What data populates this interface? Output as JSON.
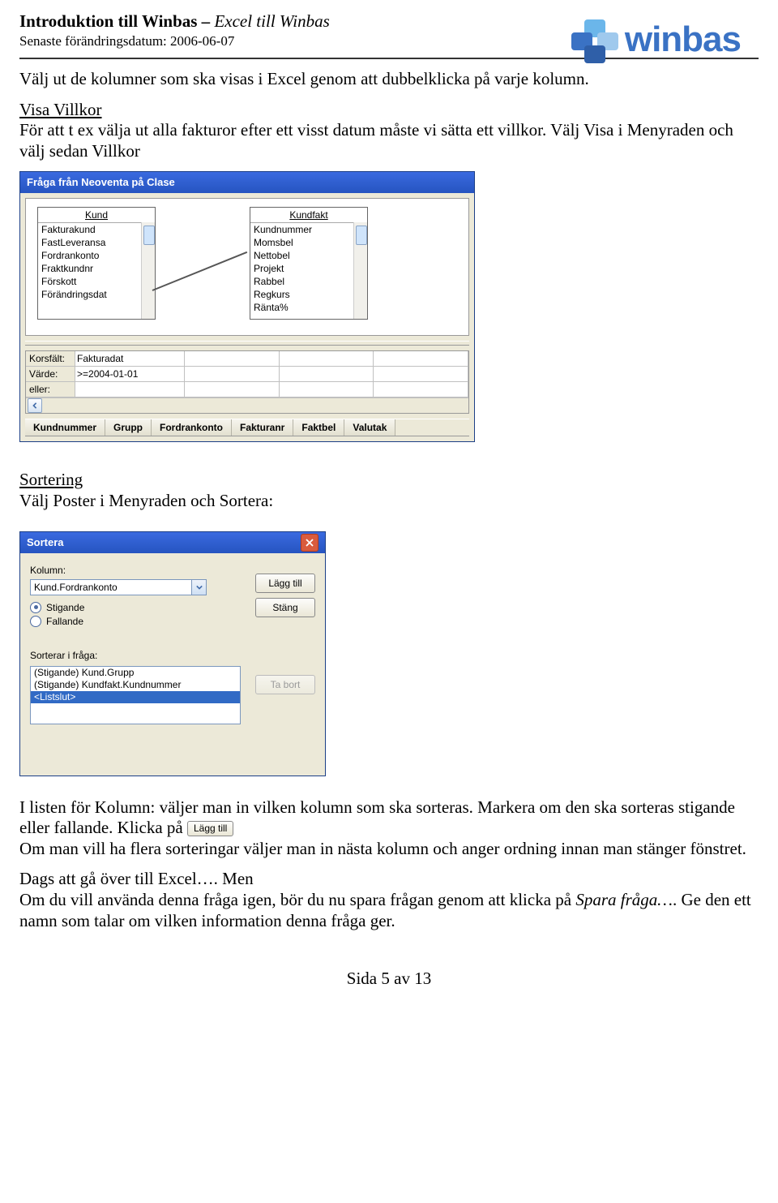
{
  "header": {
    "title_plain": "Introduktion till Winbas – ",
    "title_italic": "Excel till Winbas",
    "changed_label": "Senaste förändringsdatum: ",
    "changed_date": "2006-06-07",
    "logo_text": "winbas"
  },
  "body": {
    "p1": "Välj ut de kolumner som ska visas i Excel genom att dubbelklicka på varje kolumn.",
    "visa_villkor_head": "Visa Villkor",
    "visa_villkor_text": "För att  t ex välja ut alla fakturor efter ett visst datum måste vi sätta ett villkor. Välj Visa i Menyraden och välj sedan Villkor",
    "sortering_head": "Sortering",
    "sortering_text": "Välj Poster i Menyraden och Sortera:",
    "kolumn_text_a": "I listen för Kolumn: väljer man in vilken kolumn som ska sorteras. Markera om den ska sorteras stigande eller fallande. Klicka på ",
    "laggtill_inline": "Lägg till",
    "kolumn_text_b": "Om man vill ha flera sorteringar väljer man in nästa kolumn och anger ordning innan man stänger fönstret.",
    "dags_a": "Dags att gå över till Excel…. Men",
    "dags_b_pre": "Om du vill använda denna fråga igen, bör du nu spara frågan genom att klicka på ",
    "dags_b_italic": "Spara fråga…",
    "dags_b_post": ". Ge den ett namn som talar om vilken information denna fråga ger."
  },
  "msquery": {
    "title": "Fråga från Neoventa på Clase",
    "tables": {
      "kund": {
        "title": "Kund",
        "fields": [
          "Fakturakund",
          "FastLeveransa",
          "Fordrankonto",
          "Fraktkundnr",
          "Förskott",
          "Förändringsdat"
        ]
      },
      "kundfakt": {
        "title": "Kundfakt",
        "fields": [
          "Kundnummer",
          "Momsbel",
          "Nettobel",
          "Projekt",
          "Rabbel",
          "Regkurs",
          "Ränta%"
        ]
      }
    },
    "criteria": {
      "labels": [
        "Korsfält:",
        "Värde:",
        "eller:"
      ],
      "field": "Fakturadat",
      "value": ">=2004-01-01"
    },
    "result_cols": [
      "Kundnummer",
      "Grupp",
      "Fordrankonto",
      "Fakturanr",
      "Faktbel",
      "Valutak"
    ]
  },
  "sortdlg": {
    "title": "Sortera",
    "kolumn_label": "Kolumn:",
    "kolumn_value": "Kund.Fordrankonto",
    "btn_laggtill": "Lägg till",
    "btn_stang": "Stäng",
    "radio_stigande": "Stigande",
    "radio_fallande": "Fallande",
    "sorterar_label": "Sorterar i fråga:",
    "btn_tabort": "Ta bort",
    "listitems": [
      "(Stigande) Kund.Grupp",
      "(Stigande) Kundfakt.Kundnummer",
      "<Listslut>"
    ]
  },
  "footer": {
    "pageinfo": "Sida 5 av 13"
  }
}
